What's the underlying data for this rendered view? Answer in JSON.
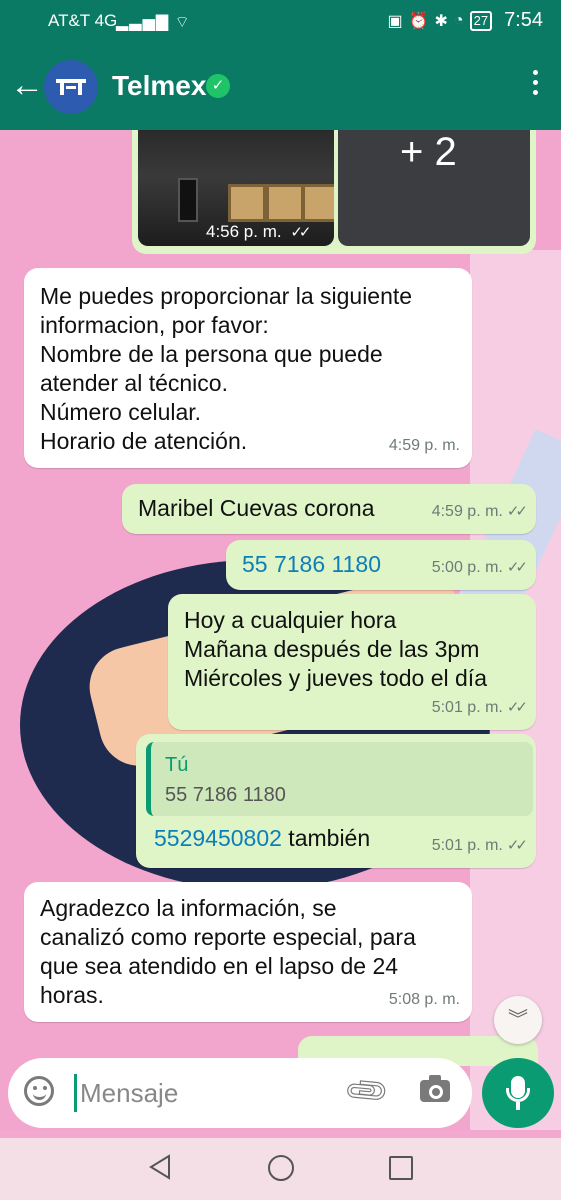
{
  "status_bar": {
    "carrier": "AT&T 4G",
    "signal_icon": "signal-icon",
    "battery": "27",
    "time": "7:54"
  },
  "header": {
    "title": "Telmex",
    "verified_icon": "verified-icon",
    "back_icon": "back-arrow-icon",
    "menu_icon": "more-vert-icon"
  },
  "image_message": {
    "extra_count": "+ 2",
    "time": "4:56 p. m."
  },
  "messages": [
    {
      "type": "incoming",
      "text": "Me puedes proporcionar la siguiente\ninformacion, por favor:\nNombre de la persona que puede\natender al técnico.\nNúmero celular.\nHorario de atención.",
      "time": "4:59 p. m."
    },
    {
      "type": "outgoing",
      "text": "Maribel Cuevas corona",
      "time": "4:59 p. m."
    },
    {
      "type": "outgoing",
      "text": "55 7186 1180",
      "time": "5:00 p. m."
    },
    {
      "type": "outgoing",
      "text": "Hoy a cualquier hora\nMañana después de las 3pm\nMiércoles y jueves todo el día",
      "time": "5:01 p. m."
    },
    {
      "type": "outgoing",
      "quote_author": "Tú",
      "quote_text": "55 7186 1180",
      "phone": "5529450802",
      "text": " también",
      "time": "5:01 p. m."
    },
    {
      "type": "incoming",
      "text": "Agradezco la información, se\ncanalizó como reporte especial, para\nque sea atendido en el lapso de 24\nhoras.",
      "time": "5:08 p. m."
    }
  ],
  "composer": {
    "placeholder": "Mensaje",
    "emoji_icon": "emoji-icon",
    "attach_icon": "paperclip-icon",
    "camera_icon": "camera-icon",
    "mic_icon": "microphone-icon"
  },
  "colors": {
    "header": "#0b7a64",
    "outgoing_bubble": "#dff5c8",
    "accent": "#0b9b73",
    "link": "#0d7fb8"
  }
}
